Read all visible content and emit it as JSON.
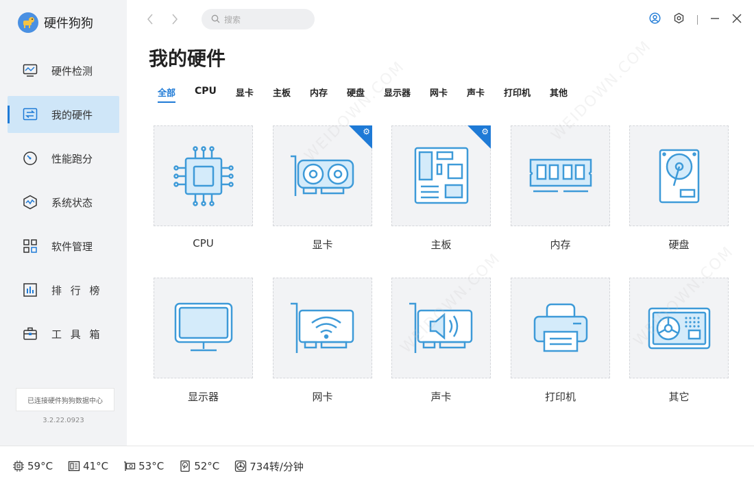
{
  "app": {
    "name": "硬件狗狗",
    "version": "3.2.22.0923",
    "connection_status": "已连接硬件狗狗数据中心"
  },
  "search": {
    "placeholder": "搜索"
  },
  "sidebar": {
    "items": [
      {
        "label": "硬件检测",
        "icon": "monitor-wave-icon",
        "active": false
      },
      {
        "label": "我的硬件",
        "icon": "chip-swap-icon",
        "active": true
      },
      {
        "label": "性能跑分",
        "icon": "gauge-icon",
        "active": false
      },
      {
        "label": "系统状态",
        "icon": "pulse-icon",
        "active": false
      },
      {
        "label": "软件管理",
        "icon": "apps-grid-icon",
        "active": false
      },
      {
        "label": "排 行 榜",
        "icon": "bar-chart-icon",
        "active": false
      },
      {
        "label": "工 具 箱",
        "icon": "toolbox-icon",
        "active": false
      }
    ]
  },
  "main": {
    "title": "我的硬件",
    "tabs": [
      {
        "label": "全部",
        "active": true
      },
      {
        "label": "CPU"
      },
      {
        "label": "显卡"
      },
      {
        "label": "主板"
      },
      {
        "label": "内存"
      },
      {
        "label": "硬盘"
      },
      {
        "label": "显示器"
      },
      {
        "label": "网卡"
      },
      {
        "label": "声卡"
      },
      {
        "label": "打印机"
      },
      {
        "label": "其他"
      }
    ],
    "cards": [
      {
        "label": "CPU",
        "icon": "cpu-icon",
        "badge": false
      },
      {
        "label": "显卡",
        "icon": "graphics-card-icon",
        "badge": true
      },
      {
        "label": "主板",
        "icon": "motherboard-icon",
        "badge": true
      },
      {
        "label": "内存",
        "icon": "ram-icon",
        "badge": false
      },
      {
        "label": "硬盘",
        "icon": "hard-disk-icon",
        "badge": false
      },
      {
        "label": "显示器",
        "icon": "monitor-icon",
        "badge": false
      },
      {
        "label": "网卡",
        "icon": "network-card-icon",
        "badge": false
      },
      {
        "label": "声卡",
        "icon": "sound-card-icon",
        "badge": false
      },
      {
        "label": "打印机",
        "icon": "printer-icon",
        "badge": false
      },
      {
        "label": "其它",
        "icon": "other-device-icon",
        "badge": false
      }
    ]
  },
  "status": [
    {
      "icon": "cpu-temp-icon",
      "value": "59°C"
    },
    {
      "icon": "mainboard-temp-icon",
      "value": "41°C"
    },
    {
      "icon": "gpu-temp-icon",
      "value": "53°C"
    },
    {
      "icon": "disk-temp-icon",
      "value": "52°C"
    },
    {
      "icon": "fan-icon",
      "value": "734转/分钟"
    }
  ],
  "watermark": "WEIDOWN.COM",
  "colors": {
    "accent": "#1e7ad6",
    "icon_stroke": "#3d9ad8",
    "icon_fill": "#d4ebfa",
    "sidebar_bg": "#f2f3f5",
    "active_bg": "#cfe6f8"
  }
}
